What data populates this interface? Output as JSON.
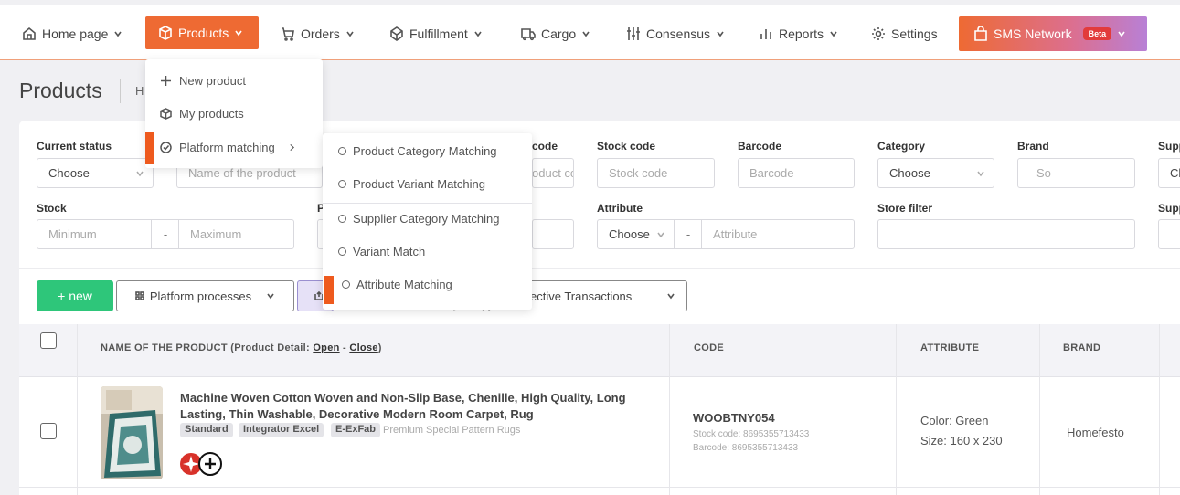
{
  "nav": {
    "home": "Home page",
    "products": "Products",
    "orders": "Orders",
    "fulfillment": "Fulfillment",
    "cargo": "Cargo",
    "consensus": "Consensus",
    "reports": "Reports",
    "settings": "Settings",
    "sms": "SMS Network",
    "beta": "Beta"
  },
  "products_menu": {
    "new_product": "New product",
    "my_products": "My products",
    "platform_matching": "Platform matching"
  },
  "platform_submenu": {
    "items": [
      "Product Category Matching",
      "Product Variant Matching",
      "Supplier Category Matching",
      "Variant Match",
      "Attribute Matching"
    ]
  },
  "page": {
    "title": "Products",
    "breadcrumb": "H"
  },
  "filters": {
    "current_status": {
      "label": "Current status",
      "value": "Choose"
    },
    "product_name": {
      "placeholder": "Name of the product"
    },
    "code": {
      "label": "code",
      "placeholder": "Product cc"
    },
    "stock_code": {
      "label": "Stock code",
      "placeholder": "Stock code"
    },
    "barcode": {
      "label": "Barcode",
      "placeholder": "Barcode"
    },
    "category": {
      "label": "Category",
      "value": "Choose"
    },
    "brand": {
      "label": "Brand",
      "placeholder": "So"
    },
    "supplier": {
      "label": "Supp",
      "value": "Ch"
    },
    "stock": {
      "label": "Stock",
      "min_placeholder": "Minimum",
      "separator": "-",
      "max_placeholder": "Maximum"
    },
    "price": {
      "label": "P"
    },
    "attribute": {
      "label": "Attribute",
      "value": "Choose",
      "separator": "-",
      "placeholder": "Attribute"
    },
    "store_filter": {
      "label": "Store filter"
    },
    "supplier2": {
      "label": "Supp"
    }
  },
  "actions": {
    "new": "+ new",
    "platform_processes": "Platform processes",
    "collective": "ollective Transactions"
  },
  "table": {
    "headers": {
      "name_prefix": "NAME OF THE PRODUCT (Product Detail: ",
      "open": "Open",
      "dash": " - ",
      "close": "Close",
      "suffix": ")",
      "code": "CODE",
      "attribute": "ATTRIBUTE",
      "brand": "BRAND"
    },
    "rows": [
      {
        "name": "Machine Woven Cotton Woven and Non-Slip Base, Chenille, High Quality, Long Lasting, Thin Washable, Decorative Modern Room Carpet, Rug",
        "tags": [
          "Standard",
          "Integrator Excel",
          "E-ExFab"
        ],
        "tag_note": "Premium Special Pattern Rugs",
        "code": "WOOBTNY054",
        "stock_code": "Stock code: 8695355713433",
        "barcode": "Barcode: 8695355713433",
        "color": "Color: Green",
        "size": "Size: 160 x 230",
        "brand": "Homefesto"
      }
    ]
  },
  "colors": {
    "accent": "#ee6a33",
    "new_button": "#2ec67a",
    "beta_badge": "#e23b3b"
  }
}
